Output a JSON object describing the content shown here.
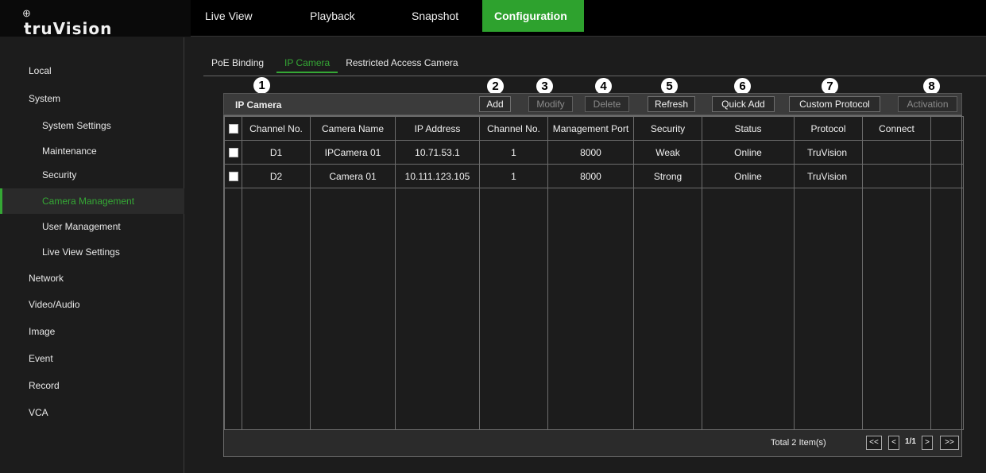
{
  "app": {
    "logo_mark": "⊕",
    "logo_text": "truVision"
  },
  "nav": [
    {
      "label": "Live View",
      "active": false
    },
    {
      "label": "Playback",
      "active": false
    },
    {
      "label": "Snapshot",
      "active": false
    },
    {
      "label": "Configuration",
      "active": true
    }
  ],
  "sidebar": [
    {
      "label": "Local",
      "level": 0
    },
    {
      "label": "System",
      "level": 0
    },
    {
      "label": "System Settings",
      "level": 1
    },
    {
      "label": "Maintenance",
      "level": 1
    },
    {
      "label": "Security",
      "level": 1
    },
    {
      "label": "Camera Management",
      "level": 1,
      "active": true
    },
    {
      "label": "User Management",
      "level": 1
    },
    {
      "label": "Live View Settings",
      "level": 1
    },
    {
      "label": "Network",
      "level": 0
    },
    {
      "label": "Video/Audio",
      "level": 0
    },
    {
      "label": "Image",
      "level": 0
    },
    {
      "label": "Event",
      "level": 0
    },
    {
      "label": "Record",
      "level": 0
    },
    {
      "label": "VCA",
      "level": 0
    }
  ],
  "tabs": [
    {
      "label": "PoE Binding",
      "active": false
    },
    {
      "label": "IP Camera",
      "active": true
    },
    {
      "label": "Restricted Access Camera",
      "active": false
    }
  ],
  "callouts": [
    "1",
    "2",
    "3",
    "4",
    "5",
    "6",
    "7",
    "8"
  ],
  "panel": {
    "title": "IP Camera",
    "buttons": [
      {
        "label": "Add",
        "disabled": false
      },
      {
        "label": "Modify",
        "disabled": true
      },
      {
        "label": "Delete",
        "disabled": true
      },
      {
        "label": "Refresh",
        "disabled": false
      },
      {
        "label": "Quick Add",
        "disabled": false
      },
      {
        "label": "Custom Protocol",
        "disabled": false
      },
      {
        "label": "Activation",
        "disabled": true
      }
    ]
  },
  "table": {
    "columns": [
      "",
      "Channel No.",
      "Camera Name",
      "IP Address",
      "Channel No.",
      "Management Port",
      "Security",
      "Status",
      "Protocol",
      "Connect",
      ""
    ],
    "rows": [
      [
        "D1",
        "IPCamera 01",
        "10.71.53.1",
        "1",
        "8000",
        "Weak",
        "Online",
        "TruVision",
        "",
        ""
      ],
      [
        "D2",
        "Camera 01",
        "10.111.123.105",
        "1",
        "8000",
        "Strong",
        "Online",
        "TruVision",
        "",
        ""
      ]
    ]
  },
  "footer": {
    "total": "Total 2 Item(s)",
    "first": "<<",
    "prev": "<",
    "page": "1/1",
    "next": ">",
    "last": ">>"
  },
  "colors": {
    "accent": "#2ea22e",
    "background": "#1c1c1c",
    "topbar": "#000000"
  }
}
